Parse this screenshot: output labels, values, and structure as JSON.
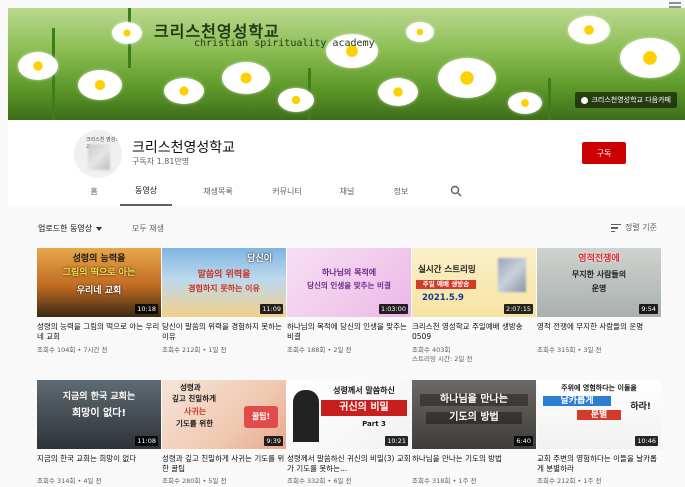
{
  "banner": {
    "title": "크리스천영성학교",
    "subtitle": "christian spirituality academy",
    "link": "크리스천영성학교 다음카페"
  },
  "channel": {
    "name": "크리스천영성학교",
    "subscribers": "구독자 1.81만명",
    "subscribe_label": "구독",
    "avatar_text": "크리스천 영성학교"
  },
  "tabs": [
    "홈",
    "동영상",
    "재생목록",
    "커뮤니티",
    "채널",
    "정보"
  ],
  "active_tab": "동영상",
  "toolbar": {
    "uploads_label": "업로드한 동영상",
    "play_all": "모두 재생",
    "sort_label": "정렬 기준"
  },
  "colors": {
    "subscribe": "#cc0000",
    "accent_red": "#cc0000"
  },
  "videos": [
    {
      "thumb_lines": [
        "성령의 능력을",
        "그림의 떡으로 아는",
        "우리네 교회"
      ],
      "duration": "10:18",
      "title": "성령의 능력을 그림의 떡으로 아는 우리네 교회",
      "views": "조회수 104회",
      "age": "7시간 전",
      "extra": ""
    },
    {
      "thumb_lines": [
        "당신이",
        "말씀의 위력을",
        "경험하지 못하는 이유"
      ],
      "duration": "11:09",
      "title": "당신이 말씀의 위력을 경험하지 못하는 이유",
      "views": "조회수 212회",
      "age": "1일 전",
      "extra": ""
    },
    {
      "thumb_lines": [
        "하나님의 목적에",
        "당신의 인생을 맞추는 비결"
      ],
      "duration": "1:03:00",
      "title": "하나님의 목적에 당신의 인생을 맞추는 비결",
      "views": "조회수 188회",
      "age": "2일 전",
      "extra": ""
    },
    {
      "thumb_lines": [
        "실시간 스트리밍",
        "주일 예배 생방송",
        "2021.5.9"
      ],
      "duration": "2:07:15",
      "title": "크리스천 영성학교 주일예배 생방송 0509",
      "views": "조회수 403회",
      "age": "",
      "extra": "스트리밍 시간: 2일 전"
    },
    {
      "thumb_lines": [
        "영적전쟁에",
        "무지한 사람들의",
        "운명"
      ],
      "duration": "9:54",
      "title": "영적 전쟁에 무지한 사람들의 운명",
      "views": "조회수 315회",
      "age": "3일 전",
      "extra": ""
    },
    {
      "thumb_lines": [
        "지금의 한국 교회는",
        "희망이 없다!"
      ],
      "duration": "11:08",
      "title": "지금의 한국 교회는 희망이 없다",
      "views": "조회수 314회",
      "age": "4일 전",
      "extra": ""
    },
    {
      "thumb_lines": [
        "성령과",
        "깊고 친밀하게",
        "사귀는",
        "기도를 위한",
        "꿀팁!"
      ],
      "duration": "9:39",
      "title": "성령과 깊고 친밀하게 사귀는 기도를 위한 꿀팁",
      "views": "조회수 280회",
      "age": "5일 전",
      "extra": ""
    },
    {
      "thumb_lines": [
        "성령께서 말씀하신",
        "귀신의 비밀",
        "Part 3"
      ],
      "duration": "10:21",
      "title": "성령께서 말씀하신 귀신의 비밀(3) 교회가 기도를 못하는...",
      "views": "조회수 332회",
      "age": "6일 전",
      "extra": ""
    },
    {
      "thumb_lines": [
        "하나님을 만나는",
        "기도의 방법"
      ],
      "duration": "6:40",
      "title": "하나님을 만나는 기도의 방법",
      "views": "조회수 318회",
      "age": "1주 전",
      "extra": ""
    },
    {
      "thumb_lines": [
        "주위에 영험하다는 이들을",
        "날카롭게",
        "분별",
        "하라!"
      ],
      "duration": "10:46",
      "title": "교회 주변의 영험하다는 이들을 날카롭게 분별하라",
      "views": "조회수 212회",
      "age": "1주 전",
      "extra": ""
    }
  ]
}
